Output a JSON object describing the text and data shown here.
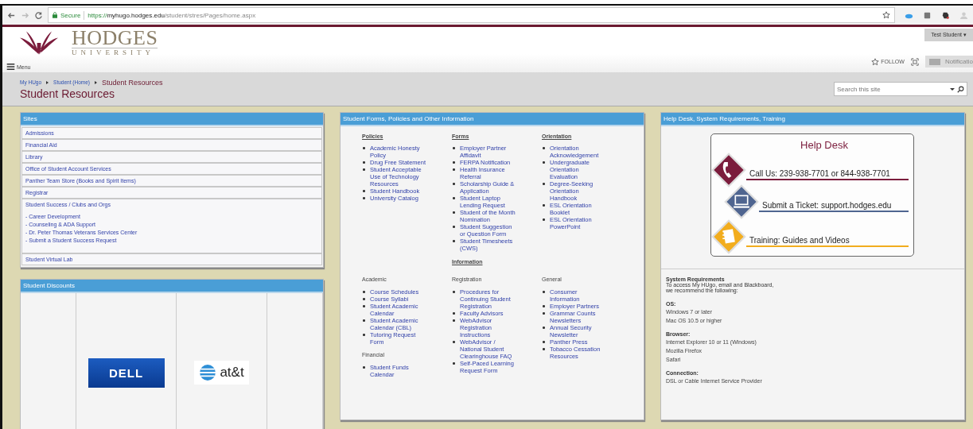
{
  "browser": {
    "secure_label": "Secure",
    "url_scheme": "https://",
    "url_host": "myhugo.hodges.edu",
    "url_path": "/student/stres/Pages/home.aspx"
  },
  "header": {
    "logo_name": "HODGES",
    "logo_sub": "UNIVERSITY",
    "menu": "Menu",
    "user": "Test Student",
    "user_caret": "▾",
    "follow": "FOLLOW",
    "notifications": "Notificatio"
  },
  "breadcrumb": [
    "My HUgo",
    "Student (Home)",
    "Student Resources"
  ],
  "page_title": "Student Resources",
  "search": {
    "placeholder": "Search this site"
  },
  "sites": {
    "title": "Sites",
    "items": [
      {
        "label": "Admissions"
      },
      {
        "label": "Financial Aid"
      },
      {
        "label": "Library"
      },
      {
        "label": "Office of Student Account Services"
      },
      {
        "label": "Panther Team Store (Books and Spirit Items)"
      },
      {
        "label": "Registrar"
      },
      {
        "label": "Student Success / Clubs and Orgs",
        "children": [
          "- Career Development",
          "- Counseling & ADA Support",
          "- Dr. Peter Thomas Veterans Services Center",
          "- Submit a Student Success Request"
        ]
      },
      {
        "label": "Student Virtual Lab"
      }
    ]
  },
  "discounts": {
    "title": "Student Discounts",
    "logos": [
      {
        "kind": "dell",
        "label": "DELL"
      },
      {
        "kind": "att",
        "label": "at&t"
      }
    ]
  },
  "forms": {
    "title": "Student Forms, Policies and Other Information",
    "top_columns": [
      {
        "heading": "Policies",
        "links": [
          "Academic Honesty Policy",
          "Drug Free Statement",
          "Student Acceptable Use of Technology Resources",
          "Student Handbook",
          "University Catalog"
        ]
      },
      {
        "heading": "Forms",
        "links": [
          "Employer Partner Affidavit",
          "FERPA Notification",
          "Health Insurance Referral",
          "Scholarship Guide & Application",
          "Student Laptop Lending Request",
          "Student of the Month Nomination",
          "Student Suggestion or Question Form",
          "Student Timesheets (CWS)"
        ]
      },
      {
        "heading": "Orientation",
        "links": [
          "Orientation Acknowledgement",
          "Undergraduate Orientation Evaluation",
          "Degree-Seeking Orientation Handbook",
          "ESL Orientation Booklet",
          "ESL Orientation PowerPoint"
        ]
      }
    ],
    "info_heading": "Information",
    "info_columns": [
      {
        "groups": [
          {
            "heading": "Academic",
            "links": [
              "Course Schedules",
              "Course Syllabi",
              "Student Academic Calendar",
              "Student Academic Calendar (CBL)",
              "Tutoring Request Form"
            ]
          },
          {
            "heading": "Financial",
            "links": [
              "Student Funds Calendar"
            ]
          }
        ]
      },
      {
        "groups": [
          {
            "heading": "Registration",
            "links": [
              "Procedures for Continuing Student Registration",
              "Faculty Advisors",
              "WebAdvisor Registration Instructions",
              "WebAdvisor / National Student Clearinghouse FAQ",
              "Self-Paced Learning Request Form"
            ]
          }
        ]
      },
      {
        "groups": [
          {
            "heading": "General",
            "links": [
              "Consumer Information",
              "Employer Partners",
              "Grammar Counts Newsletters",
              "Annual Security Newsletter",
              "Panther Press",
              "Tobacco Cessation Resources"
            ]
          }
        ]
      }
    ]
  },
  "helpdesk": {
    "title": "Help Desk, System Requirements, Training",
    "card": {
      "heading": "Help Desk",
      "rows": [
        {
          "kind": "phone",
          "text": "Call Us: 239-938-7701 or 844-938-7701",
          "color": "#7b1c3c"
        },
        {
          "kind": "computer",
          "text": "Submit a Ticket: support.hodges.edu",
          "color": "#4f6590"
        },
        {
          "kind": "notepad",
          "text": "Training: Guides and Videos",
          "color": "#f2ad1e"
        }
      ]
    },
    "requirements": {
      "title": "System Requirements",
      "intro": [
        "To access My HUgo, email and Blackboard,",
        "we recommend the following:"
      ],
      "sections": [
        {
          "heading": "OS:",
          "items": [
            "Windows 7 or later",
            "Mac OS 10.5 or higher"
          ]
        },
        {
          "heading": "Browser:",
          "items": [
            "Internet Explorer 10 or 11 (Windows)",
            "Mozilla Firefox",
            "Safari"
          ]
        },
        {
          "heading": "Connection:",
          "items": [
            "DSL or Cable Internet Service Provider"
          ]
        }
      ]
    }
  }
}
